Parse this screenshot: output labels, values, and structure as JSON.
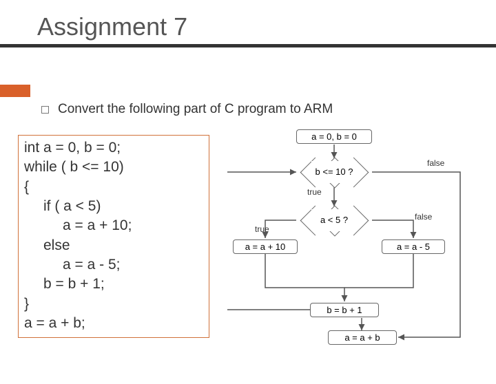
{
  "title": "Assignment 7",
  "bullet": "Convert the following part of C program to ARM",
  "code": {
    "l1": "int a = 0,  b = 0;",
    "l2": "while  ( b <= 10)",
    "l3": "{",
    "l4": "if ( a < 5)",
    "l5": "a = a + 10;",
    "l6": "else",
    "l7": "a = a  - 5;",
    "l8": "b = b + 1;",
    "l9": "}",
    "l10": "a = a + b;"
  },
  "chart_data": {
    "type": "flowchart",
    "nodes": [
      {
        "id": "start",
        "shape": "rect",
        "label": "a = 0, b = 0"
      },
      {
        "id": "cond1",
        "shape": "diamond",
        "label": "b  <= 10 ?"
      },
      {
        "id": "cond2",
        "shape": "diamond",
        "label": "a  < 5 ?"
      },
      {
        "id": "inc10",
        "shape": "rect",
        "label": "a = a + 10"
      },
      {
        "id": "dec5",
        "shape": "rect",
        "label": "a = a - 5"
      },
      {
        "id": "bpp",
        "shape": "rect",
        "label": "b = b + 1"
      },
      {
        "id": "sum",
        "shape": "rect",
        "label": "a = a + b"
      }
    ],
    "edges": [
      {
        "from": "start",
        "to": "cond1"
      },
      {
        "from": "cond1",
        "to": "cond2",
        "label": "true"
      },
      {
        "from": "cond1",
        "to": "sum",
        "label": "false"
      },
      {
        "from": "cond2",
        "to": "inc10",
        "label": "true"
      },
      {
        "from": "cond2",
        "to": "dec5",
        "label": "false"
      },
      {
        "from": "inc10",
        "to": "bpp"
      },
      {
        "from": "dec5",
        "to": "bpp"
      },
      {
        "from": "bpp",
        "to": "cond1"
      }
    ]
  },
  "labels": {
    "true": "true",
    "false": "false"
  }
}
